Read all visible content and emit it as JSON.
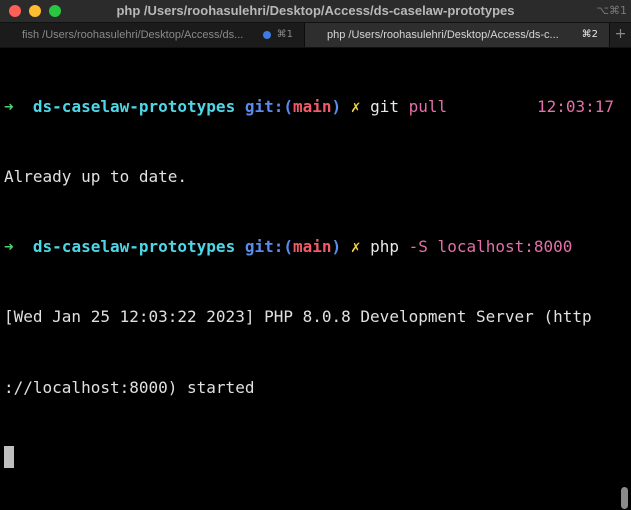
{
  "window": {
    "title": "php /Users/roohasulehri/Desktop/Access/ds-caselaw-prototypes",
    "shortcut": "⌥⌘1"
  },
  "tabs": [
    {
      "label": "fish /Users/roohasulehri/Desktop/Access/ds...",
      "shortcut": "⌘1",
      "has_activity_dot": true,
      "active": false
    },
    {
      "label": "php /Users/roohasulehri/Desktop/Access/ds-c...",
      "shortcut": "⌘2",
      "has_activity_dot": false,
      "active": true
    }
  ],
  "new_tab_label": "+",
  "terminal": {
    "line1": {
      "arrow": "➜",
      "dir": "ds-caselaw-prototypes",
      "git_prefix": "git:(",
      "branch": "main",
      "git_suffix": ")",
      "dirty": "✗",
      "cmd": "git",
      "arg": "pull",
      "time": "12:03:17"
    },
    "line2": "Already up to date.",
    "line3": {
      "arrow": "➜",
      "dir": "ds-caselaw-prototypes",
      "git_prefix": "git:(",
      "branch": "main",
      "git_suffix": ")",
      "dirty": "✗",
      "cmd": "php",
      "arg": "-S localhost:8000"
    },
    "line4": "[Wed Jan 25 12:03:22 2023] PHP 8.0.8 Development Server (http",
    "line5": "://localhost:8000) started"
  },
  "colors": {
    "prompt_arrow": "#4fd26e",
    "directory": "#4fd6e6",
    "git_label": "#5a8cf0",
    "branch": "#f05a6a",
    "dirty_marker": "#f0d040",
    "argument": "#e370a8",
    "background": "#000000"
  }
}
